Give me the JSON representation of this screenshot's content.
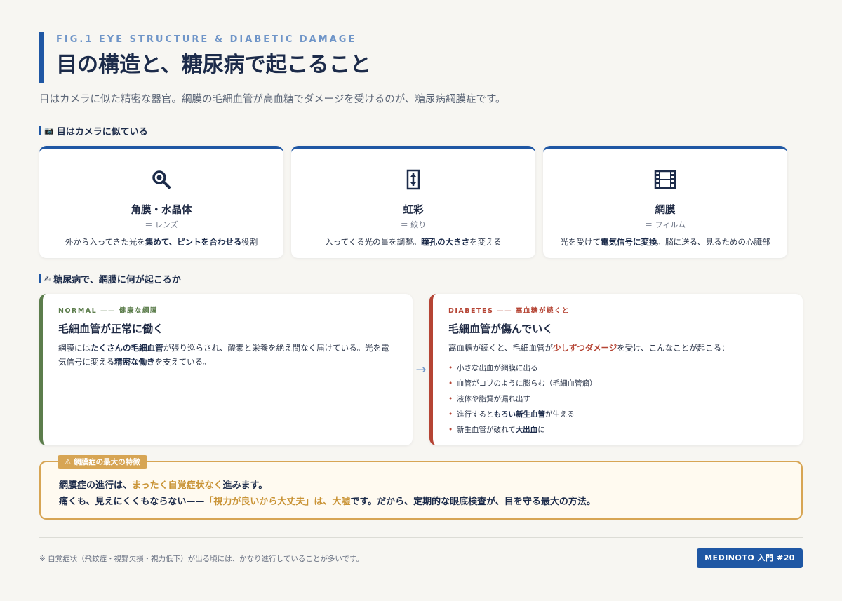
{
  "header": {
    "eyebrow": "FIG.1 EYE STRUCTURE & DIABETIC DAMAGE",
    "title": "目の構造と、糖尿病で起こること",
    "subtitle": "目はカメラに似た精密な器官。網膜の毛細血管が高血糖でダメージを受けるのが、糖尿病網膜症です。"
  },
  "section1": {
    "icon": "camera-icon",
    "heading": "目はカメラに似ている",
    "cards": [
      {
        "icon": "magnifier-icon",
        "title": "角膜・水晶体",
        "eq": "＝ レンズ",
        "desc_a": "外から入ってきた光を",
        "desc_b": "集めて、ピントを合わせる",
        "desc_c": "役割"
      },
      {
        "icon": "aperture-icon",
        "title": "虹彩",
        "eq": "＝ 絞り",
        "desc_a": "入ってくる光の量を調整。",
        "desc_b": "瞳孔の大きさ",
        "desc_c": "を変える"
      },
      {
        "icon": "film-icon",
        "title": "網膜",
        "eq": "＝ フィルム",
        "desc_a": "光を受けて",
        "desc_b": "電気信号に変換",
        "desc_c": "。脳に送る、見るための心臓部"
      }
    ]
  },
  "section2": {
    "icon": "pencil-icon",
    "heading": "糖尿病で、網膜に何が起こるか",
    "normal": {
      "tag": "NORMAL —— 健康な網膜",
      "title": "毛細血管が正常に働く",
      "t1": "網膜には",
      "t2": "たくさんの毛細血管",
      "t3": "が張り巡らされ、酸素と栄養を絶え間なく届けている。光を電気信号に変える",
      "t4": "精密な働き",
      "t5": "を支えている。"
    },
    "arrow": "→",
    "diabetes": {
      "tag": "DIABETES —— 高血糖が続くと",
      "title": "毛細血管が傷んでいく",
      "t1": "高血糖が続くと、毛細血管が",
      "t2": "少しずつダメージ",
      "t3": "を受け、こんなことが起こる：",
      "items": [
        "小さな出血が網膜に出る",
        "血管がコブのように膨らむ（毛細血管瘤）",
        "液体や脂質が漏れ出す"
      ],
      "item4_a": "進行すると",
      "item4_b": "もろい新生血管",
      "item4_c": "が生える",
      "item5_a": "新生血管が破れて",
      "item5_b": "大出血",
      "item5_c": "に"
    }
  },
  "alert": {
    "badge_icon": "⚠",
    "badge": "網膜症の最大の特徴",
    "l1a": "網膜症の進行は、",
    "l1b": "まったく自覚症状なく",
    "l1c": "進みます。",
    "l2a": "痛くも、見えにくくもならない——",
    "l2b": "「視力が良いから大丈夫」は、大嘘",
    "l2c": "です。だから、定期的な眼底検査が、目を守る最大の方法。"
  },
  "footer": {
    "note": "※ 自覚症状（飛蚊症・視野欠損・視力低下）が出る頃には、かなり進行していることが多いです。",
    "badge": "MEDINOTO 入門 #20"
  }
}
